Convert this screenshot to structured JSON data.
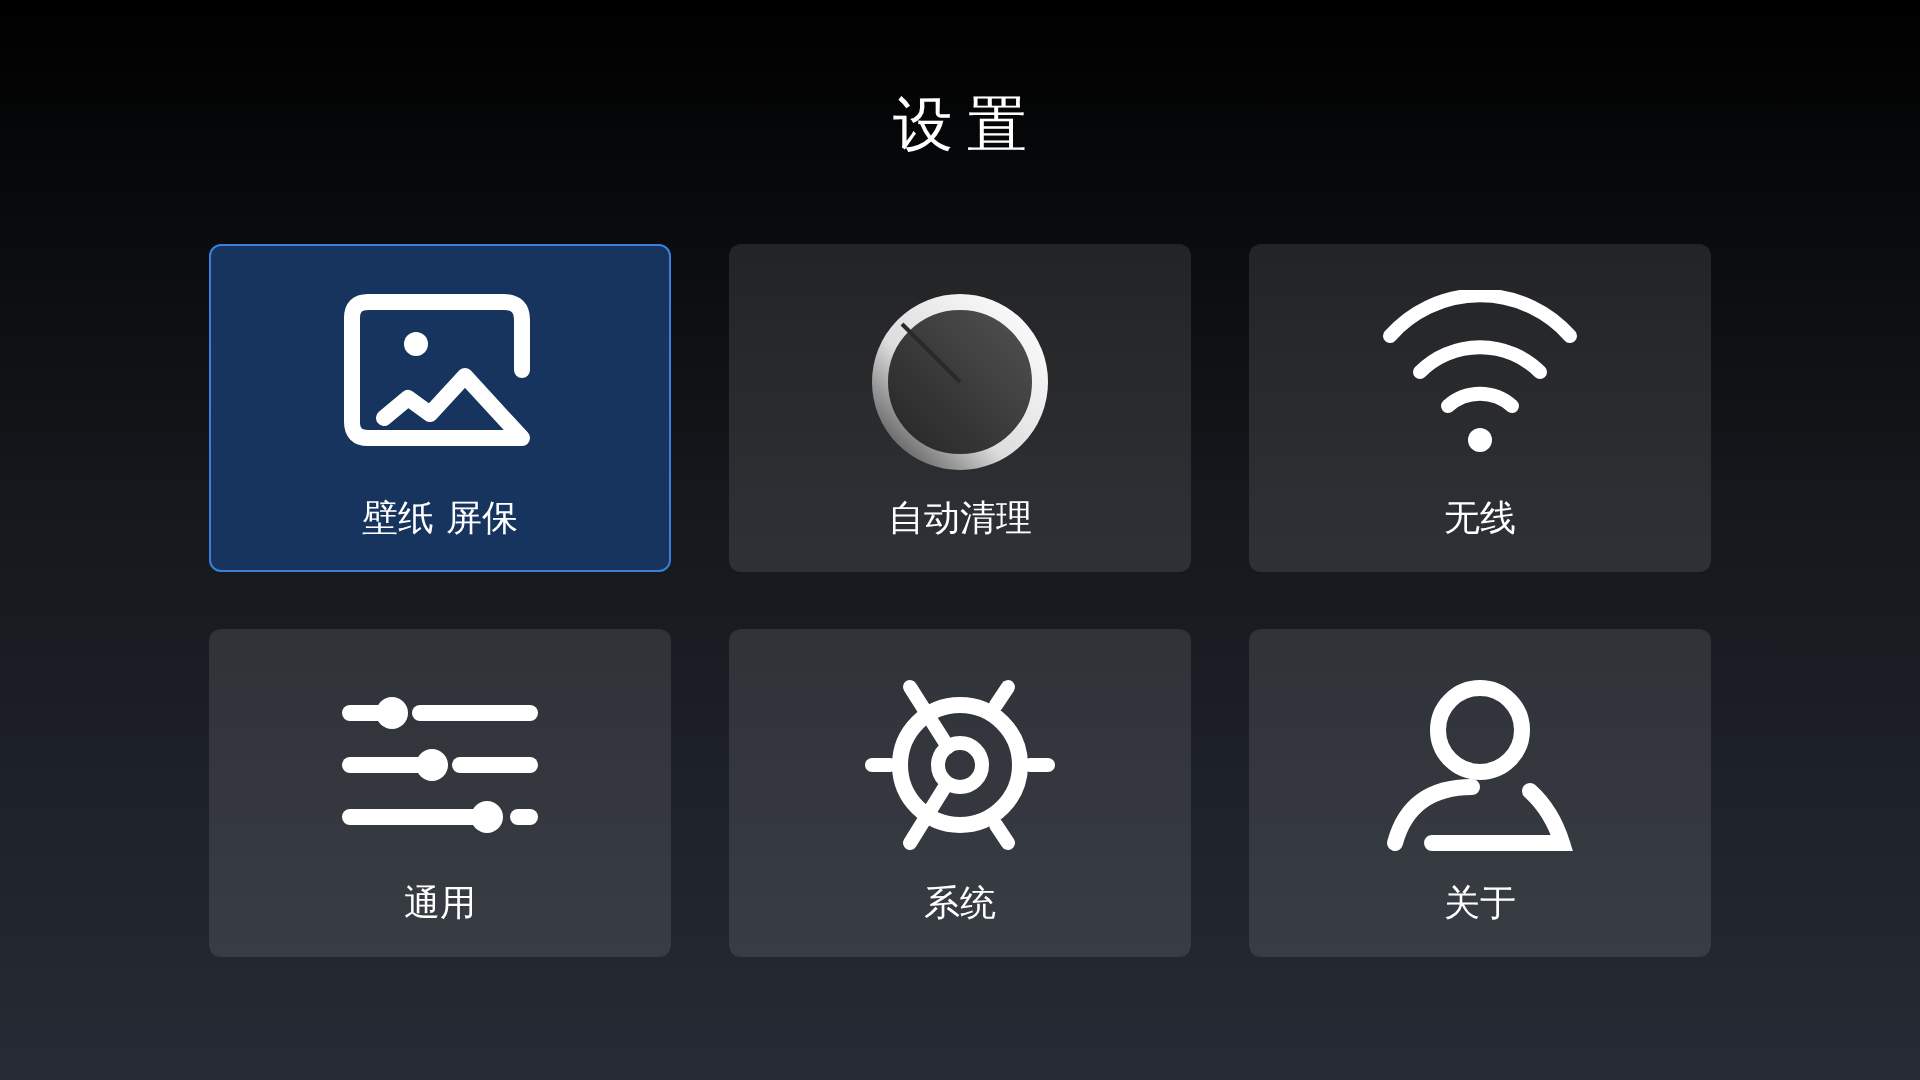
{
  "title": "设置",
  "tiles": [
    {
      "label": "壁纸 屏保",
      "kind": "wallpaper",
      "selected": true
    },
    {
      "label": "自动清理",
      "kind": "cleanup",
      "selected": false
    },
    {
      "label": "无线",
      "kind": "wireless",
      "selected": false
    },
    {
      "label": "通用",
      "kind": "general",
      "selected": false
    },
    {
      "label": "系统",
      "kind": "system",
      "selected": false
    },
    {
      "label": "关于",
      "kind": "about",
      "selected": false
    }
  ]
}
